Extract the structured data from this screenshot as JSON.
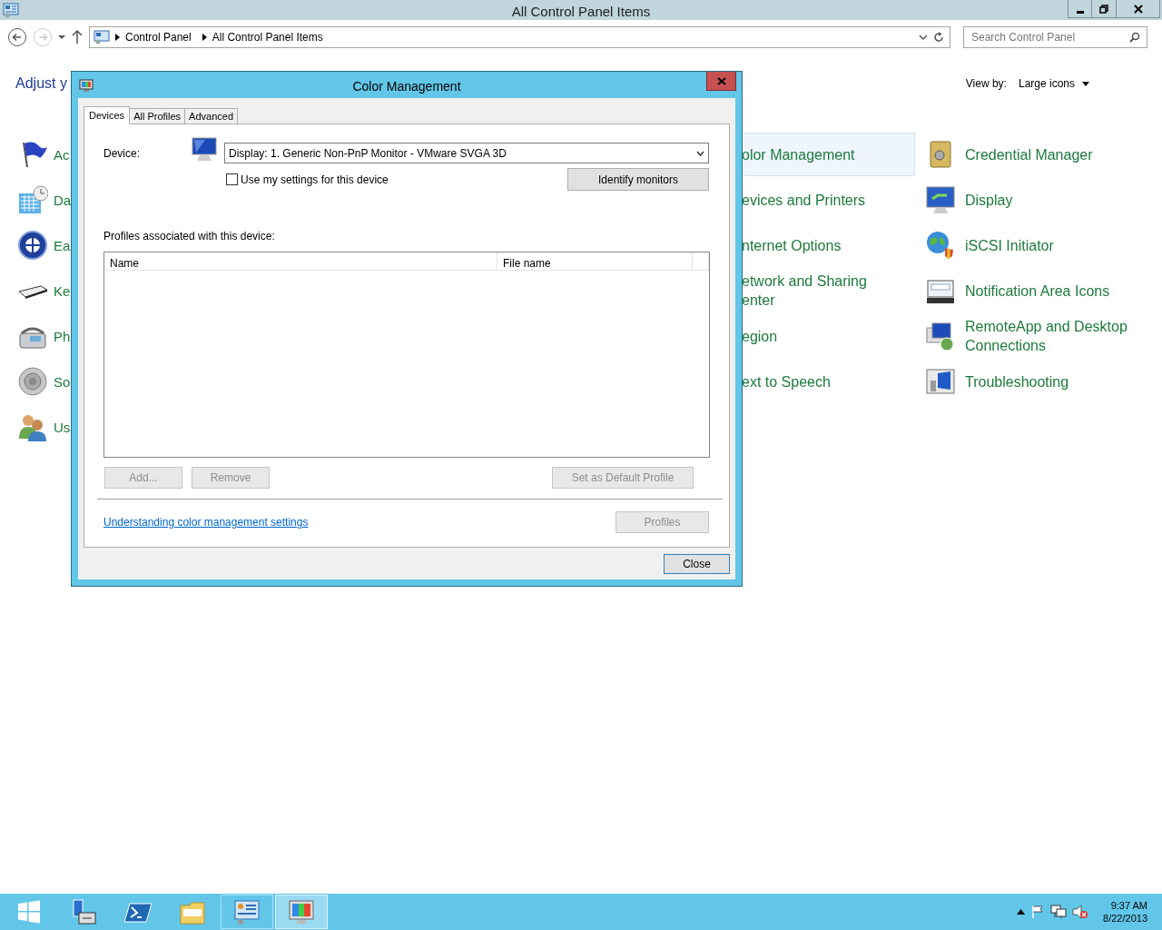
{
  "window": {
    "title": "All Control Panel Items"
  },
  "nav_buttons": [
    {
      "kind": "back",
      "disabled": false
    },
    {
      "kind": "forward",
      "disabled": true
    },
    {
      "kind": "recent",
      "disabled": false
    },
    {
      "kind": "up",
      "disabled": false
    }
  ],
  "address_bar": {
    "breadcrumb": [
      "Control Panel",
      "All Control Panel Items"
    ]
  },
  "search": {
    "placeholder": "Search Control Panel"
  },
  "heading": "Adjust y",
  "view_by": {
    "label": "View by:",
    "value": "Large icons"
  },
  "item_columns": [
    [
      {
        "label": "Ac",
        "kind": "flag",
        "selected": false
      },
      {
        "label": "Da",
        "kind": "calendar",
        "selected": false
      },
      {
        "label": "Ea",
        "kind": "ease",
        "selected": false
      },
      {
        "label": "Ke",
        "kind": "keyboard",
        "selected": false
      },
      {
        "label": "Ph",
        "kind": "phone",
        "selected": false
      },
      {
        "label": "So",
        "kind": "speaker",
        "selected": false
      },
      {
        "label": "Us",
        "kind": "users",
        "selected": false
      }
    ],
    [
      {
        "label": "olor Management",
        "selected": true
      },
      {
        "label": "evices and Printers",
        "selected": false
      },
      {
        "label": "nternet Options",
        "selected": false
      },
      {
        "label": "etwork and Sharing\nenter",
        "selected": false
      },
      {
        "label": "egion",
        "selected": false
      },
      {
        "label": "ext to Speech",
        "selected": false
      }
    ],
    [
      {
        "label": "Credential Manager",
        "kind": "safe",
        "selected": false
      },
      {
        "label": "Display",
        "kind": "display",
        "selected": false
      },
      {
        "label": "iSCSI Initiator",
        "kind": "globe",
        "selected": false
      },
      {
        "label": "Notification Area Icons",
        "kind": "notification",
        "selected": false
      },
      {
        "label": "RemoteApp and Desktop Connections",
        "kind": "remote",
        "selected": false
      },
      {
        "label": "Troubleshooting",
        "kind": "troubleshoot",
        "selected": false
      }
    ]
  ],
  "dialog": {
    "title": "Color Management",
    "tabs": [
      {
        "label": "Devices",
        "selected": true
      },
      {
        "label": "All Profiles",
        "selected": false
      },
      {
        "label": "Advanced",
        "selected": false
      }
    ],
    "device_label": "Device:",
    "device": "Display: 1. Generic Non-PnP Monitor - VMware SVGA 3D",
    "use_my_settings": {
      "label": "Use my settings for this device",
      "checked": false
    },
    "identify_button": {
      "label": "Identify monitors",
      "disabled": false
    },
    "profiles_label": "Profiles associated with this device:",
    "profiles_table": {
      "columns": [
        "Name",
        "File name"
      ]
    },
    "profile_buttons": [
      {
        "label": "Add...",
        "disabled": true
      },
      {
        "label": "Remove",
        "disabled": true
      },
      {
        "label": "Set as Default Profile",
        "disabled": true
      }
    ],
    "help_link": "Understanding color management settings",
    "profiles_button": {
      "label": "Profiles",
      "disabled": true
    },
    "close_button": {
      "label": "Close",
      "disabled": false
    }
  },
  "taskbar": {
    "apps": [
      {
        "kind": "server-manager",
        "open": false,
        "selected": false
      },
      {
        "kind": "powershell",
        "open": false,
        "selected": false
      },
      {
        "kind": "explorer",
        "open": false,
        "selected": false
      },
      {
        "kind": "control-panel",
        "open": true,
        "selected": false
      },
      {
        "kind": "color-management",
        "open": true,
        "selected": true
      }
    ],
    "time": "9:37 AM",
    "date": "8/22/2013"
  }
}
